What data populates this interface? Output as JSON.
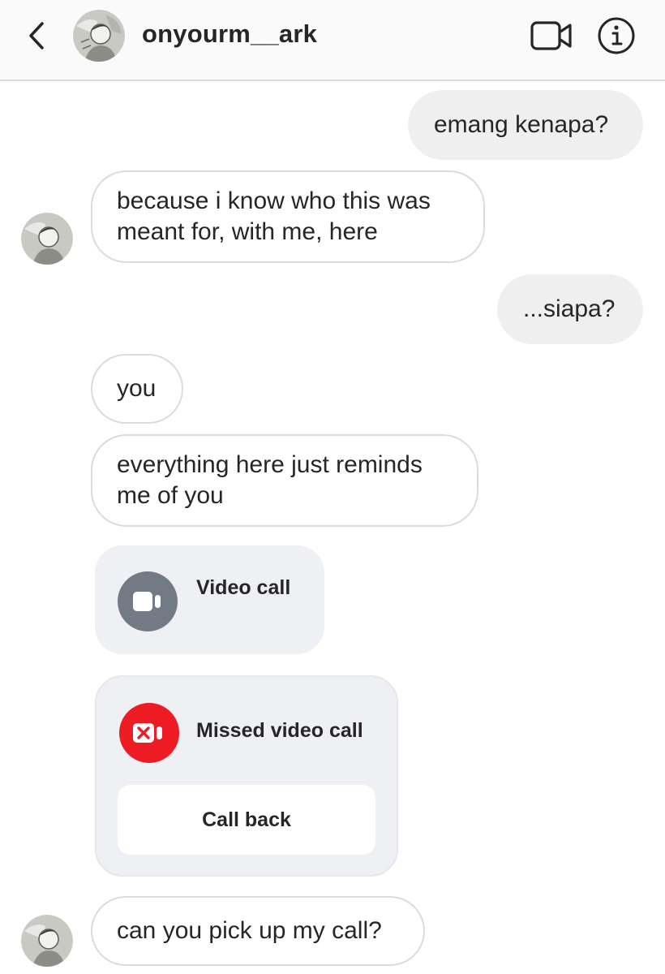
{
  "header": {
    "username": "onyourm__ark"
  },
  "messages": {
    "m1": "emang kenapa?",
    "m2_line1": "because i know who this was",
    "m2_line2": "meant for, with me, here",
    "m3": "...siapa?",
    "m4": "you",
    "m5_line1": "everything here just reminds",
    "m5_line2": "me of you",
    "m6": "can you pick up my call?"
  },
  "calls": {
    "video_call_label": "Video call",
    "missed_call_label": "Missed video call",
    "call_back_label": "Call back"
  },
  "colors": {
    "header_bg": "#fafafa",
    "outgoing_bubble": "#efefef",
    "incoming_border": "#dbdbdb",
    "call_card_bg": "#eff0f4",
    "video_call_icon_bg": "#737a86",
    "missed_call_icon_bg": "#ed1b24"
  },
  "icons": {
    "back": "chevron-left-icon",
    "video": "video-camera-icon",
    "info": "info-icon"
  }
}
